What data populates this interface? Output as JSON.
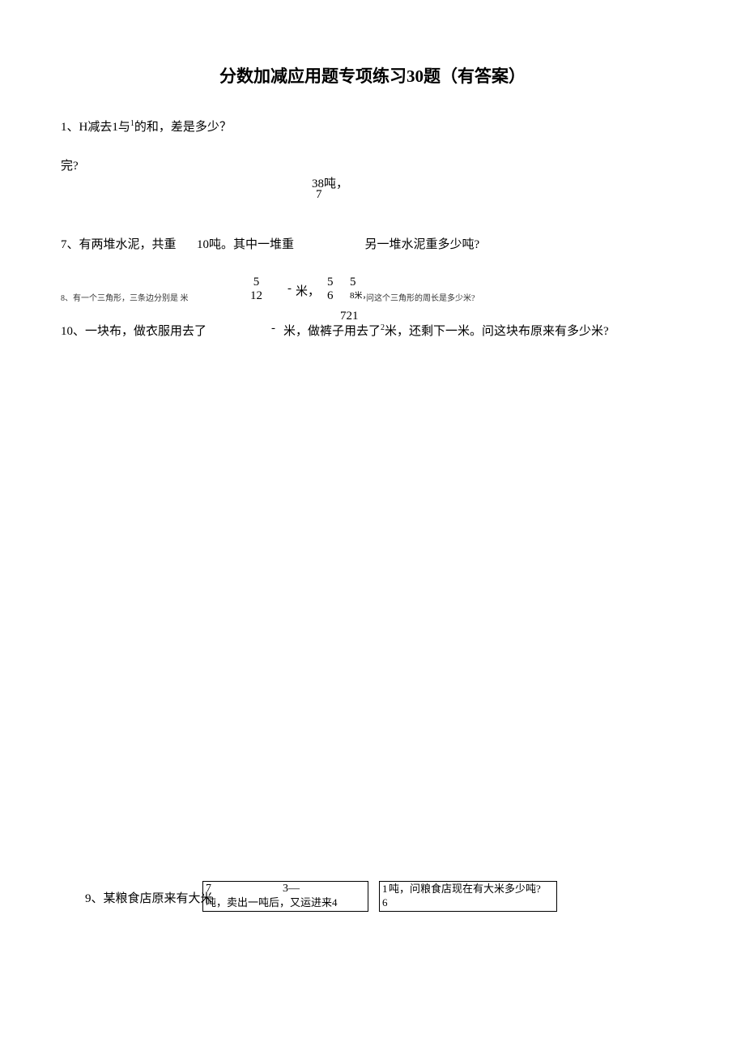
{
  "title": "分数加减应用题专项练习30题（有答案）",
  "q1": {
    "prefix": "1、H减去1与",
    "sup": "1",
    "suffix": "的和，差是多少？"
  },
  "wan": "完?",
  "ton38": "38吨，",
  "seven": "7",
  "q7": {
    "p1": "7、有两堆水泥，共重",
    "p2": "10吨。其中一堆重",
    "p3": "另一堆水泥重多少吨?"
  },
  "q8": {
    "main_faded": "8、有一个三角形，三条边分别是  米",
    "frac1_num": "5",
    "frac1_den": "12",
    "dash": "-",
    "mi": "米，",
    "f2_top": "5",
    "f2_bot": "6",
    "f3_top": "5",
    "f3_bot": "8",
    "f3_tail": "米，",
    "tail_faded": "问这个三角形的周长是多少米?"
  },
  "q10": {
    "p1": "10、一块布，做衣服用去了",
    "num721": "721",
    "dash": "-",
    "mi": "米，做裤子用去了",
    "sup2": "2",
    "tail": "米，还剩下一米。问这块布原来有多少米?"
  },
  "q9": {
    "label": "9、某粮食店原来有大米",
    "box1_7": "7",
    "box1_3": "3—",
    "box1_text": "吨，卖出一吨后，又运进来4",
    "box2_1": "1",
    "box2_6": "6",
    "box2_text": "吨，问粮食店现在有大米多少吨?"
  }
}
